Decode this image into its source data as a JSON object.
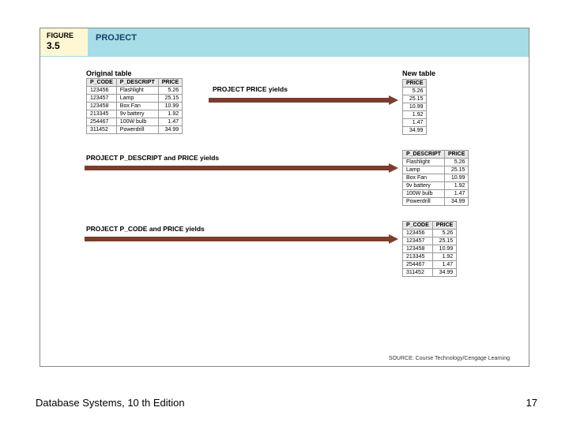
{
  "footer": {
    "left": "Database Systems, 10 th Edition",
    "right": "17"
  },
  "figure": {
    "label_word": "FIGURE",
    "label_num": "3.5",
    "title": "PROJECT",
    "source": "SOURCE: Course Technology/Cengage Learning",
    "captions": {
      "original": "Original table",
      "new": "New table"
    },
    "yields": {
      "y1": "PROJECT PRICE yields",
      "y2": "PROJECT P_DESCRIPT and PRICE yields",
      "y3": "PROJECT P_CODE and PRICE yields"
    },
    "original": {
      "headers": [
        "P_CODE",
        "P_DESCRIPT",
        "PRICE"
      ],
      "rows": [
        [
          "123456",
          "Flashlight",
          "5.26"
        ],
        [
          "123457",
          "Lamp",
          "25.15"
        ],
        [
          "123458",
          "Box Fan",
          "10.99"
        ],
        [
          "213345",
          "9v battery",
          "1.92"
        ],
        [
          "254467",
          "100W bulb",
          "1.47"
        ],
        [
          "311452",
          "Powerdrill",
          "34.99"
        ]
      ]
    },
    "price_only": {
      "headers": [
        "PRICE"
      ],
      "rows": [
        [
          "5.26"
        ],
        [
          "25.15"
        ],
        [
          "10.99"
        ],
        [
          "1.92"
        ],
        [
          "1.47"
        ],
        [
          "34.99"
        ]
      ]
    },
    "descript_price": {
      "headers": [
        "P_DESCRIPT",
        "PRICE"
      ],
      "rows": [
        [
          "Flashlight",
          "5.26"
        ],
        [
          "Lamp",
          "25.15"
        ],
        [
          "Box Fan",
          "10.99"
        ],
        [
          "9v battery",
          "1.92"
        ],
        [
          "100W bulb",
          "1.47"
        ],
        [
          "Powerdrill",
          "34.99"
        ]
      ]
    },
    "code_price": {
      "headers": [
        "P_CODE",
        "PRICE"
      ],
      "rows": [
        [
          "123456",
          "5.26"
        ],
        [
          "123457",
          "25.15"
        ],
        [
          "123458",
          "10.99"
        ],
        [
          "213345",
          "1.92"
        ],
        [
          "254467",
          "1.47"
        ],
        [
          "311452",
          "34.99"
        ]
      ]
    }
  }
}
